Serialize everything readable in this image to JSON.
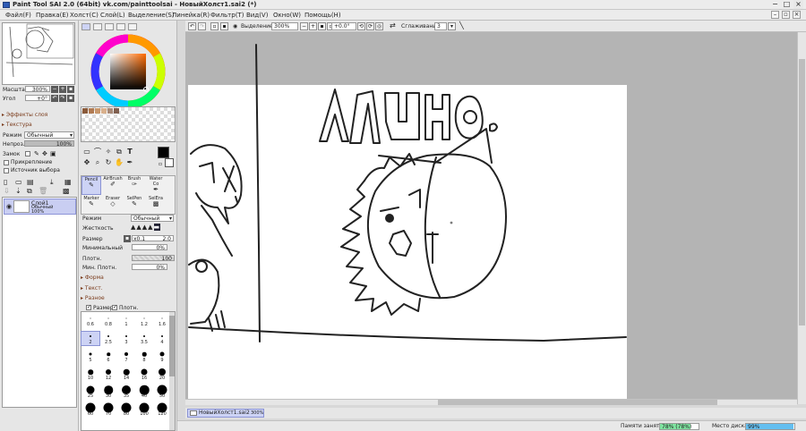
{
  "window": {
    "title": "Paint Tool SAI 2.0 (64bit) vk.com/painttoolsai - НовыйХолст1.sai2 (*)",
    "controls": {
      "minimize": "−",
      "maximize": "□",
      "close": "×"
    }
  },
  "menu": {
    "items": [
      "Файл(F)",
      "Правка(E)",
      "Холст(C)",
      "Слой(L)",
      "Выделение(S)",
      "Линейка(R)",
      "Фильтр(T)",
      "Вид(V)",
      "Окно(W)",
      "Помощь(H)"
    ]
  },
  "navigator": {
    "zoom_label": "Масштаб",
    "zoom_value": "300%",
    "angle_label": "Угол",
    "angle_value": "+0°"
  },
  "layer_panel": {
    "effects_label": "Эффекты слоя",
    "texture_label": "Текстура",
    "mode_label": "Режим",
    "mode_value": "Обычный",
    "opacity_label": "Непроз.",
    "opacity_value": "100%",
    "opacity_fraction": 1.0,
    "lock_label": "Замок",
    "clip_label": "Прикрепление",
    "source_label": "Источник выбора",
    "layers": [
      {
        "name": "Слой1",
        "mode": "Обычный",
        "opacity": "100%"
      }
    ]
  },
  "colors": {
    "foreground": "#000000",
    "background": "#ffffff",
    "selected_hue_color": "#7a2a00",
    "swatches": [
      "#8a5a3a",
      "#b07a52",
      "#c8976c",
      "#d9b08c",
      "#a88a78",
      "#806050"
    ]
  },
  "tools": {
    "text_tool_glyph": "T",
    "brushes": [
      {
        "name": "Pencil",
        "selected": true
      },
      {
        "name": "AirBrush",
        "selected": false
      },
      {
        "name": "Brush",
        "selected": false
      },
      {
        "name": "Water Co",
        "selected": false
      },
      {
        "name": "Marker",
        "selected": false
      },
      {
        "name": "Eraser",
        "selected": false
      },
      {
        "name": "SelPen",
        "selected": false
      },
      {
        "name": "SelEra",
        "selected": false
      }
    ]
  },
  "brush_settings": {
    "mode_label": "Режим",
    "mode_value": "Обычный",
    "hardness_label": "Жесткость",
    "size_label": "Размер",
    "size_multiplier": "x0.1",
    "size_value": "2.0",
    "min_size_label": "Минимальный",
    "min_size_value": "0%",
    "density_label": "Плотн.",
    "density_value": "100",
    "density_fraction": 1.0,
    "min_density_label": "Мин. Плотн.",
    "min_density_value": "0%",
    "shape_label": "Форма",
    "texture_label": "Текст.",
    "misc_label": "Разное",
    "size_check_label": "Размер",
    "density_check_label": "Плотн."
  },
  "brush_sizes": [
    {
      "label": "0.6"
    },
    {
      "label": "0.8"
    },
    {
      "label": "1"
    },
    {
      "label": "1.2"
    },
    {
      "label": "1.6"
    },
    {
      "label": "2",
      "selected": true
    },
    {
      "label": "2.5"
    },
    {
      "label": "3"
    },
    {
      "label": "3.5"
    },
    {
      "label": "4"
    },
    {
      "label": "5"
    },
    {
      "label": "6"
    },
    {
      "label": "7"
    },
    {
      "label": "8"
    },
    {
      "label": "9"
    },
    {
      "label": "10"
    },
    {
      "label": "12"
    },
    {
      "label": "14"
    },
    {
      "label": "16"
    },
    {
      "label": "20"
    },
    {
      "label": "25"
    },
    {
      "label": "30"
    },
    {
      "label": "35"
    },
    {
      "label": "40"
    },
    {
      "label": "50"
    },
    {
      "label": "60"
    },
    {
      "label": "70"
    },
    {
      "label": "80"
    },
    {
      "label": "100"
    },
    {
      "label": "120"
    }
  ],
  "canvas_toolbar": {
    "selection_label": "Выделение",
    "zoom_value": "300%",
    "angle_value": "+0.0°",
    "smoothing_label": "Сглаживание",
    "smoothing_value": "3"
  },
  "document_tab": {
    "name": "НовыйХолст1.sai2",
    "zoom": "300%"
  },
  "status": {
    "memory_label": "Памяти занято",
    "memory_value": "78% (78%)",
    "memory_fraction": 0.78,
    "memory_color": "#7fe3a0",
    "disk_label": "Место диска",
    "disk_value": "99%",
    "disk_fraction": 0.99,
    "disk_color": "#64bff0"
  }
}
